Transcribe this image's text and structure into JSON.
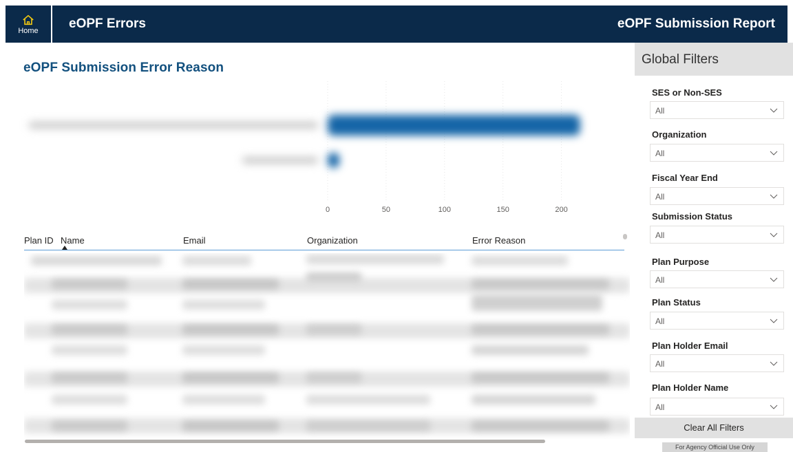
{
  "header": {
    "home_label": "Home",
    "page_title": "eOPF Errors",
    "report_title": "eOPF Submission Report",
    "bg_color": "#0b2a4a"
  },
  "chart": {
    "title": "eOPF Submission Error Reason"
  },
  "chart_data": {
    "type": "bar",
    "orientation": "horizontal",
    "categories": [
      "",
      ""
    ],
    "values": [
      216,
      10
    ],
    "xlim": [
      0,
      225
    ],
    "x_ticks": [
      "0",
      "50",
      "100",
      "150",
      "200"
    ],
    "grid": true,
    "bar_color": "#1565a7"
  },
  "table": {
    "columns": [
      "Plan ID",
      "Name",
      "Email",
      "Organization",
      "Error Reason"
    ],
    "sort_column": "Name",
    "sort_direction": "ascending"
  },
  "filters": {
    "title": "Global Filters",
    "items": [
      {
        "label": "SES or Non-SES",
        "value": "All"
      },
      {
        "label": "Organization",
        "value": "All"
      },
      {
        "label": "Fiscal Year End",
        "value": "All"
      },
      {
        "label": "Submission Status",
        "value": "All"
      },
      {
        "label": "Plan Purpose",
        "value": "All"
      },
      {
        "label": "Plan Status",
        "value": "All"
      },
      {
        "label": "Plan Holder Email",
        "value": "All"
      },
      {
        "label": "Plan Holder Name",
        "value": "All"
      }
    ],
    "clear_label": "Clear All Filters",
    "footer_note": "For Agency Official Use Only"
  },
  "icons": {
    "home": "home-icon",
    "dropdown": "chevron-down-icon"
  }
}
